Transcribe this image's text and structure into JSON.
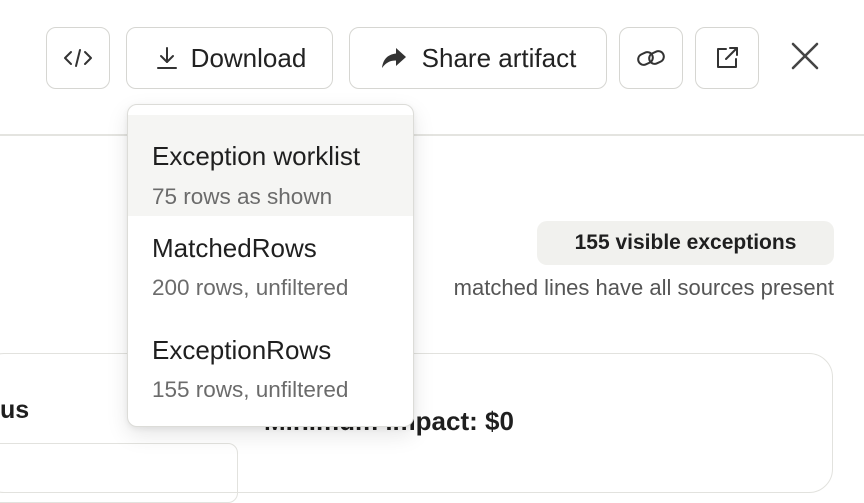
{
  "toolbar": {
    "download_label": "Download",
    "share_label": "Share artifact"
  },
  "icons": {
    "code": "code-icon",
    "download": "download-icon",
    "share": "share-arrow-icon",
    "link": "link-icon",
    "external": "external-link-icon",
    "close": "close-icon"
  },
  "download_menu": {
    "items": [
      {
        "title": "Exception worklist",
        "subtitle": "75 rows as shown"
      },
      {
        "title": "MatchedRows",
        "subtitle": "200 rows, unfiltered"
      },
      {
        "title": "ExceptionRows",
        "subtitle": "155 rows, unfiltered"
      }
    ]
  },
  "main": {
    "badge": "155 visible exceptions",
    "note": "matched lines have all sources present",
    "status_label": "us",
    "impact_label": "Minimum impact: $0"
  },
  "colors": {
    "border": "#d6d6d2",
    "badge_bg": "#f1f1ee",
    "menu_highlight": "#f5f5f3",
    "text": "#1f1f1f",
    "muted": "#6b6b6b"
  }
}
